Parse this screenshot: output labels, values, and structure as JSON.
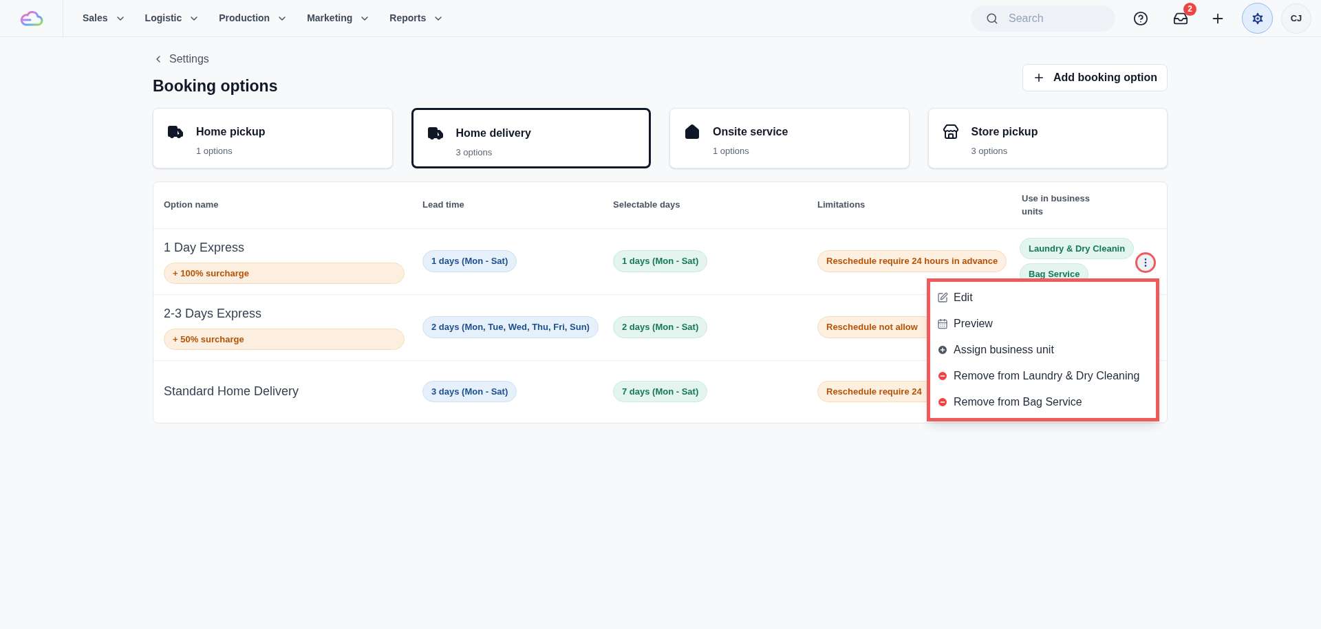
{
  "nav": {
    "items": [
      {
        "label": "Sales"
      },
      {
        "label": "Logistic"
      },
      {
        "label": "Production"
      },
      {
        "label": "Marketing"
      },
      {
        "label": "Reports"
      }
    ],
    "search": {
      "placeholder": "Search"
    },
    "inbox_badge": "2",
    "settings_selected": true,
    "avatar": "CJ"
  },
  "breadcrumb": "Settings",
  "title": "Booking options",
  "add_button": "Add booking option",
  "cards": [
    {
      "kind": "pickup",
      "title": "Home pickup",
      "subtitle": "1 options",
      "selected": false
    },
    {
      "kind": "delivery",
      "title": "Home delivery",
      "subtitle": "3 options",
      "selected": true
    },
    {
      "kind": "onsite",
      "title": "Onsite service",
      "subtitle": "1 options",
      "selected": false
    },
    {
      "kind": "store",
      "title": "Store pickup",
      "subtitle": "3 options",
      "selected": false
    }
  ],
  "table": {
    "columns": [
      "Option name",
      "Lead time",
      "Selectable days",
      "Limitations",
      "Use in business units"
    ],
    "rows": [
      {
        "name": "1 Day Express",
        "surcharge": "+ 100% surcharge",
        "lead_time": "1 days  (Mon - Sat)",
        "selectable_days": "1 days (Mon - Sat)",
        "limitation": "Reschedule require 24 hours in advance",
        "business_units": [
          "Laundry & Dry Cleanin",
          "Bag Service"
        ]
      },
      {
        "name": "2-3 Days Express",
        "surcharge": "+ 50% surcharge",
        "lead_time": "2 days  (Mon, Tue, Wed, Thu, Fri, Sun)",
        "selectable_days": "2 days (Mon - Sat)",
        "limitation": "Reschedule not allow"
      },
      {
        "name": "Standard Home Delivery",
        "lead_time": "3 days  (Mon - Sat)",
        "selectable_days": "7 days (Mon - Sat)",
        "limitation": "Reschedule require 24"
      }
    ]
  },
  "menu": {
    "items": [
      {
        "kind": "edit",
        "label": "Edit"
      },
      {
        "kind": "preview",
        "label": "Preview"
      },
      {
        "kind": "assign",
        "label": "Assign business unit"
      },
      {
        "kind": "remove",
        "label": "Remove from Laundry & Dry Cleaning"
      },
      {
        "kind": "remove",
        "label": "Remove from Bag Service"
      }
    ]
  }
}
